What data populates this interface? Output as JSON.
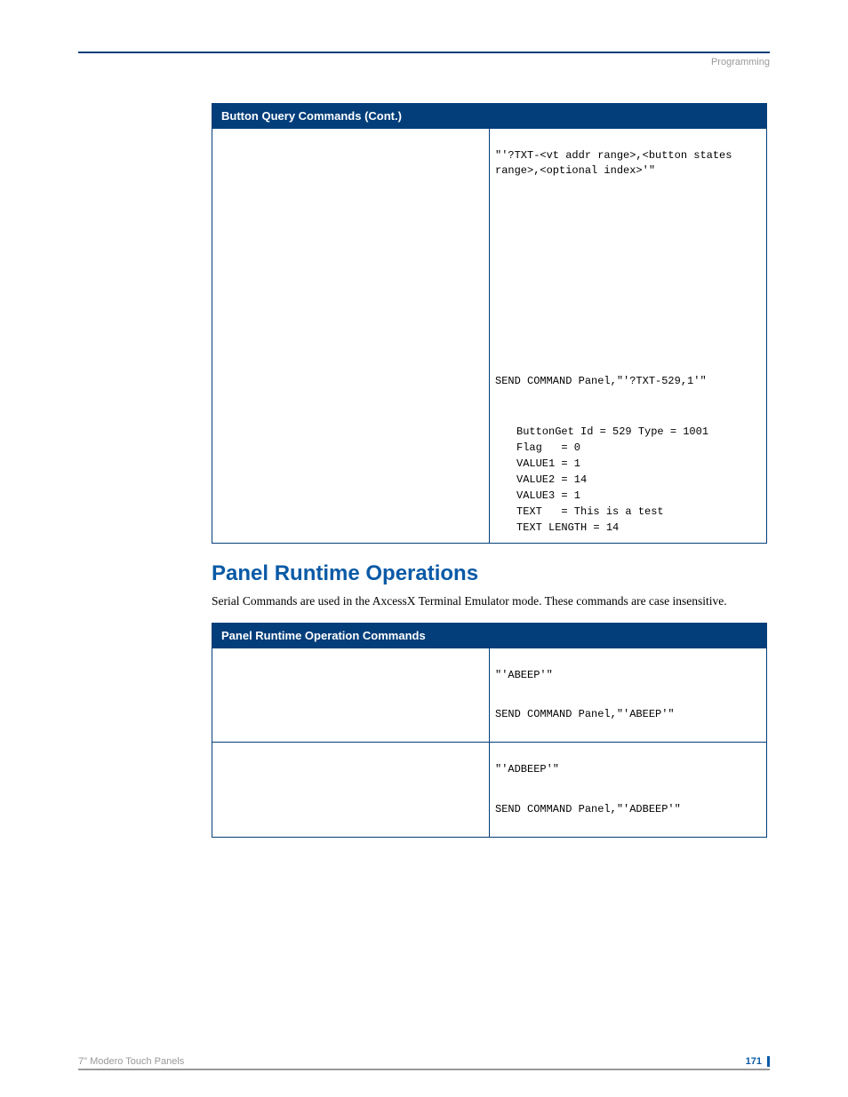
{
  "header": {
    "section": "Programming"
  },
  "table1": {
    "title": "Button Query Commands (Cont.)",
    "syntax": "\"'?TXT-<vt addr range>,<button states range>,<optional index>'\"",
    "example_cmd": "SEND COMMAND Panel,\"'?TXT-529,1'\"",
    "out_l1": "ButtonGet Id = 529 Type = 1001",
    "out_l2": "Flag   = 0",
    "out_l3": "VALUE1 = 1",
    "out_l4": "VALUE2 = 14",
    "out_l5": "VALUE3 = 1",
    "out_l6": "TEXT   = This is a test",
    "out_l7": "TEXT LENGTH = 14"
  },
  "section": {
    "title": "Panel Runtime Operations",
    "intro": "Serial Commands are used in the AxcessX Terminal Emulator mode. These commands are case insensitive."
  },
  "table2": {
    "title": "Panel Runtime Operation Commands",
    "r1_syntax": "\"'ABEEP'\"",
    "r1_example": "SEND COMMAND Panel,\"'ABEEP'\"",
    "r2_syntax": "\"'ADBEEP'\"",
    "r2_example": "SEND COMMAND Panel,\"'ADBEEP'\""
  },
  "footer": {
    "title": "7\" Modero Touch Panels",
    "page": "171"
  }
}
